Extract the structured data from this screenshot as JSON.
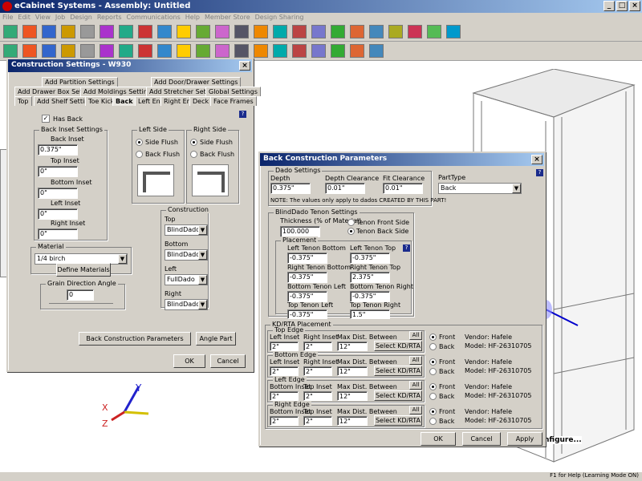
{
  "app": {
    "title": "eCabinet Systems - Assembly: Untitled"
  },
  "menu": [
    "File",
    "Edit",
    "View",
    "Job",
    "Design",
    "Reports",
    "Communications",
    "Help",
    "Member Store",
    "Design Sharing"
  ],
  "status": {
    "text": "F1 for Help (Learning Mode ON)"
  },
  "canvas": {
    "configure_text": "nfigure..."
  },
  "construction": {
    "title": "Construction Settings - W930",
    "tabs_row1": [
      "Add Partition Settings",
      "Add Door/Drawer Settings"
    ],
    "tabs_row2": [
      "Add Drawer Box Settings",
      "Add Moldings Settings",
      "Add Stretcher Settings",
      "Global Settings"
    ],
    "tabs_row3": [
      "Top",
      "Add Shelf Settings",
      "Toe Kick",
      "Back",
      "Left End",
      "Right End",
      "Deck",
      "Face Frames"
    ],
    "has_back": "Has Back",
    "inset_group": "Back Inset Settings",
    "back_inset_label": "Back Inset",
    "back_inset": "0.375\"",
    "top_inset_label": "Top Inset",
    "top_inset": "0\"",
    "bottom_inset_label": "Bottom Inset",
    "bottom_inset": "0\"",
    "left_inset_label": "Left Inset",
    "left_inset": "0\"",
    "right_inset_label": "Right Inset",
    "right_inset": "0\"",
    "left_side": {
      "label": "Left Side",
      "flush": "Side Flush",
      "back": "Back Flush"
    },
    "right_side": {
      "label": "Right Side",
      "flush": "Side Flush",
      "back": "Back Flush"
    },
    "material_group": "Material",
    "material": "1/4 birch",
    "define_materials": "Define Materials",
    "grain_label": "Grain Direction Angle",
    "grain": "0",
    "construction_group": "Construction",
    "top_label": "Top",
    "top_value": "BlindDado",
    "bottom_label": "Bottom",
    "bottom_value": "BlindDado",
    "left_label": "Left",
    "left_value": "FullDado",
    "right_label": "Right",
    "right_value": "BlindDado",
    "back_params_button": "Back Construction Parameters",
    "angle_part_button": "Angle Part",
    "ok": "OK",
    "cancel": "Cancel"
  },
  "back": {
    "title": "Back Construction Parameters",
    "dado_group": "Dado Settings",
    "depth_label": "Depth",
    "depth": "0.375\"",
    "depth_clear_label": "Depth Clearance",
    "depth_clear": "0.01\"",
    "fit_clear_label": "Fit Clearance",
    "fit_clear": "0.01\"",
    "note": "NOTE: The values only apply to dados CREATED BY THIS PART!",
    "parttype_label": "PartType",
    "parttype": "Back",
    "tenon_group": "BlindDado Tenon Settings",
    "thickness_label": "Thickness (% of Material)",
    "thickness": "100.000",
    "tenon_front": "Tenon Front Side",
    "tenon_back": "Tenon Back Side",
    "placement_group": "Placement",
    "ltb_label": "Left Tenon Bottom",
    "ltb": "-0.375\"",
    "ltt_label": "Left Tenon Top",
    "ltt": "-0.375\"",
    "rtb_label": "Right Tenon Bottom",
    "rtb": "-0.375\"",
    "rtt_label": "Right Tenon Top",
    "rtt": "2.375\"",
    "btl_label": "Bottom Tenon Left",
    "btl": "-0.375\"",
    "btr_label": "Bottom Tenon Right",
    "btr": "-0.375\"",
    "ttl_label": "Top Tenon Left",
    "ttl": "-0.375\"",
    "ttr_label": "Top Tenon Right",
    "ttr": "1.5\"",
    "kd_group": "KD/RTA Placement",
    "edges": [
      {
        "name": "Top Edge",
        "c1": "Left Inset",
        "v1": "2\"",
        "c2": "Right Inset",
        "v2": "2\"",
        "c3": "Max Dist. Between",
        "v3": "12\""
      },
      {
        "name": "Bottom Edge",
        "c1": "Left Inset",
        "v1": "2\"",
        "c2": "Right Inset",
        "v2": "2\"",
        "c3": "Max Dist. Between",
        "v3": "12\""
      },
      {
        "name": "Left Edge",
        "c1": "Bottom Inset",
        "v1": "2\"",
        "c2": "Top Inset",
        "v2": "2\"",
        "c3": "Max Dist. Between",
        "v3": "12\""
      },
      {
        "name": "Right Edge",
        "c1": "Bottom Inset",
        "v1": "2\"",
        "c2": "Top Inset",
        "v2": "2\"",
        "c3": "Max Dist. Between",
        "v3": "12\""
      }
    ],
    "all": "All",
    "select_kd": "Select KD/RTA",
    "front": "Front",
    "back_opt": "Back",
    "vendor": "Vendor: Hafele",
    "model": "Model: HF-26310705",
    "ok": "OK",
    "cancel": "Cancel",
    "apply": "Apply"
  },
  "axes": {
    "x": "X",
    "y": "Y",
    "z": "Z"
  }
}
